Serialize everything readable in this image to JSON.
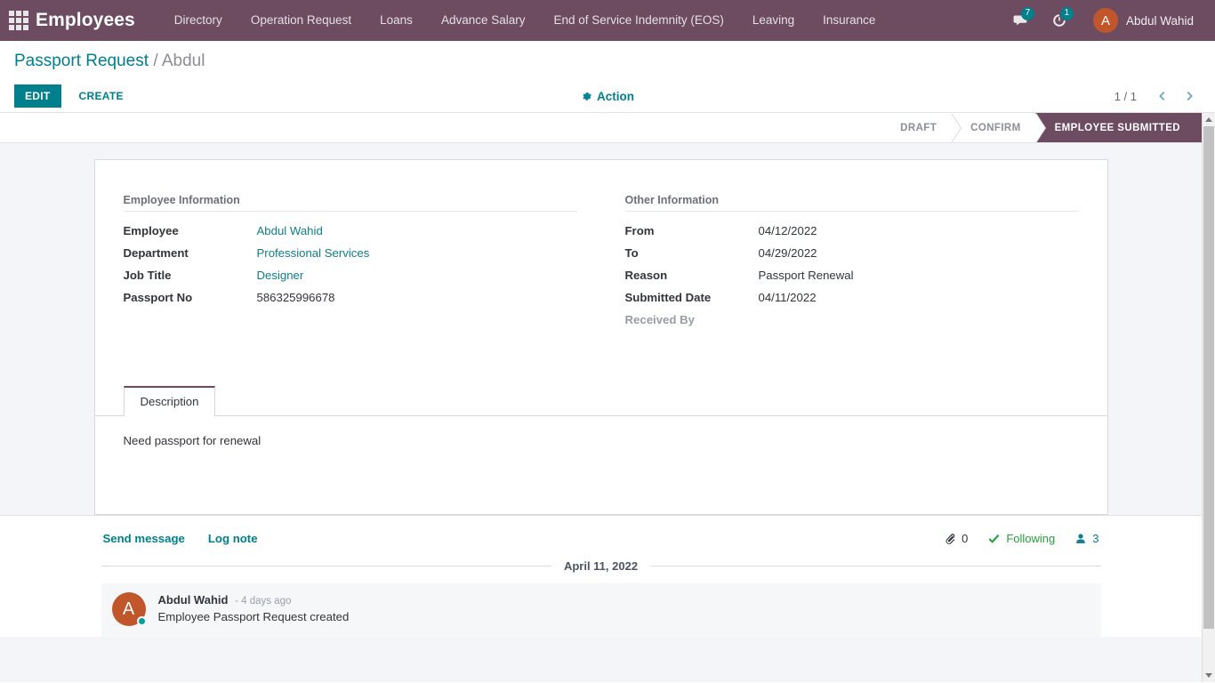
{
  "navbar": {
    "apps_icon": "apps-grid-icon",
    "brand": "Employees",
    "items": [
      {
        "label": "Directory"
      },
      {
        "label": "Operation Request"
      },
      {
        "label": "Loans"
      },
      {
        "label": "Advance Salary"
      },
      {
        "label": "End of Service Indemnity (EOS)"
      },
      {
        "label": "Leaving"
      },
      {
        "label": "Insurance"
      }
    ],
    "messages_icon": "chat-bubble-icon",
    "messages_count": "7",
    "activities_icon": "clock-activity-icon",
    "activities_count": "1",
    "user": {
      "initial": "A",
      "name": "Abdul Wahid"
    }
  },
  "control_panel": {
    "breadcrumb_root": "Passport Request",
    "breadcrumb_sep": "/",
    "breadcrumb_leaf": "Abdul",
    "edit_label": "EDIT",
    "create_label": "CREATE",
    "action_label": "Action",
    "action_icon": "gear-icon",
    "pager_value": "1 / 1",
    "pager_prev_icon": "chevron-left-icon",
    "pager_next_icon": "chevron-right-icon"
  },
  "statusbar": {
    "stages": [
      {
        "label": "DRAFT",
        "active": false
      },
      {
        "label": "CONFIRM",
        "active": false
      },
      {
        "label": "EMPLOYEE SUBMITTED",
        "active": true
      }
    ],
    "active_color": "#6d4c61"
  },
  "form": {
    "left_group": {
      "title": "Employee Information",
      "fields": [
        {
          "label": "Employee",
          "value": "Abdul Wahid",
          "link": true
        },
        {
          "label": "Department",
          "value": "Professional Services",
          "link": true
        },
        {
          "label": "Job Title",
          "value": "Designer",
          "link": true
        },
        {
          "label": "Passport No",
          "value": "586325996678",
          "link": false
        }
      ]
    },
    "right_group": {
      "title": "Other Information",
      "fields": [
        {
          "label": "From",
          "value": "04/12/2022",
          "link": false
        },
        {
          "label": "To",
          "value": "04/29/2022",
          "link": false
        },
        {
          "label": "Reason",
          "value": "Passport Renewal",
          "link": false
        },
        {
          "label": "Submitted Date",
          "value": "04/11/2022",
          "link": false
        },
        {
          "label": "Received By",
          "value": "",
          "link": false,
          "empty": true
        }
      ]
    },
    "notebook": {
      "tabs": [
        {
          "label": "Description",
          "active": true
        }
      ],
      "description_text": "Need passport for renewal"
    }
  },
  "chatter": {
    "send_message_label": "Send message",
    "log_note_label": "Log note",
    "attachments_icon": "paperclip-icon",
    "attachments_count": "0",
    "follow_icon": "check-icon",
    "follow_label": "Following",
    "followers_icon": "user-icon",
    "followers_count": "3",
    "date_separator": "April 11, 2022",
    "messages": [
      {
        "avatar_initial": "A",
        "author": "Abdul Wahid",
        "time": "- 4 days ago",
        "text": "Employee Passport Request created"
      }
    ]
  },
  "theme": {
    "navbar_bg": "#6d4c61",
    "accent": "#00808c",
    "avatar_bg": "#c0562a",
    "following_green": "#28a03c"
  }
}
